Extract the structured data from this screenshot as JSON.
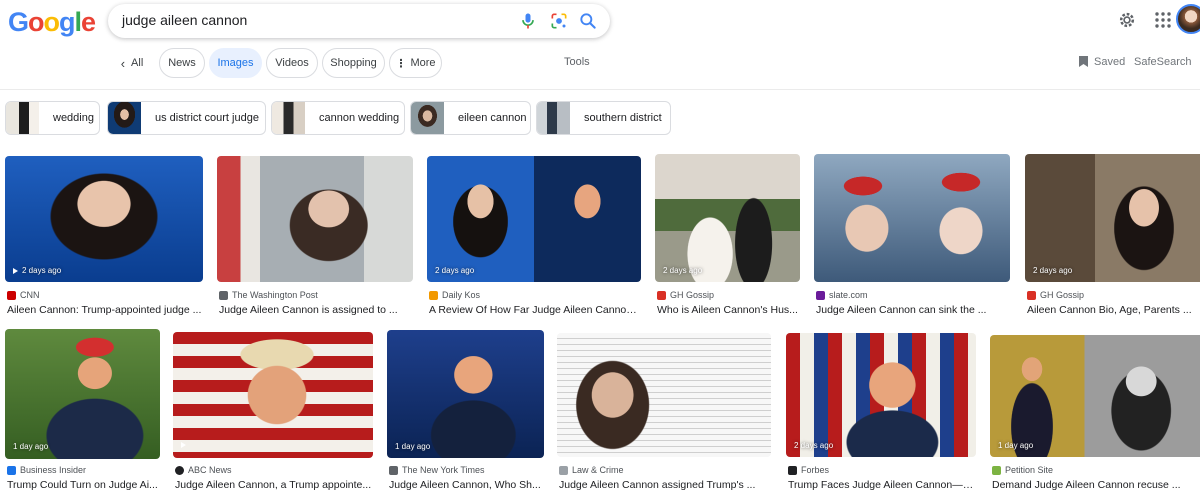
{
  "logo": {
    "letters": [
      "G",
      "o",
      "o",
      "g",
      "l",
      "e"
    ],
    "colors": [
      "#4285f4",
      "#ea4335",
      "#fbbc05",
      "#4285f4",
      "#34a853",
      "#ea4335"
    ]
  },
  "search": {
    "query": "judge aileen cannon",
    "mic_icon": "mic-icon",
    "lens_icon": "lens-icon",
    "search_icon": "search-icon"
  },
  "header": {
    "settings_icon": "gear-icon",
    "apps_icon": "apps-grid-icon",
    "account_icon": "avatar"
  },
  "tabs": {
    "all": "All",
    "news": "News",
    "images": "Images",
    "videos": "Videos",
    "shopping": "Shopping",
    "more": "More",
    "tools": "Tools",
    "saved": "Saved",
    "safesearch": "SafeSearch"
  },
  "chips": [
    {
      "label": "wedding"
    },
    {
      "label": "us district court judge"
    },
    {
      "label": "cannon wedding"
    },
    {
      "label": "eileen cannon"
    },
    {
      "label": "southern district"
    }
  ],
  "results": [
    {
      "source": "CNN",
      "favicon": "#cc0000",
      "title": "Aileen Cannon: Trump-appointed judge ...",
      "badge": "2 days ago",
      "video": true
    },
    {
      "source": "The Washington Post",
      "favicon": "#5f6368",
      "title": "Judge Aileen Cannon is assigned to ...",
      "badge": "",
      "video": false
    },
    {
      "source": "Daily Kos",
      "favicon": "#f29900",
      "title": "A Review Of How Far Judge Aileen Cannon ...",
      "badge": "2 days ago",
      "video": false
    },
    {
      "source": "GH Gossip",
      "favicon": "#d93025",
      "title": "Who is Aileen Cannon's Hus...",
      "badge": "2 days ago",
      "video": false
    },
    {
      "source": "slate.com",
      "favicon": "#6a1b9a",
      "title": "Judge Aileen Cannon can sink the ...",
      "badge": "",
      "video": false
    },
    {
      "source": "GH Gossip",
      "favicon": "#d93025",
      "title": "Aileen Cannon Bio, Age, Parents ...",
      "badge": "2 days ago",
      "video": false
    },
    {
      "source": "Business Insider",
      "favicon": "#1a73e8",
      "title": "Trump Could Turn on Judge Ai...",
      "badge": "1 day ago",
      "video": false
    },
    {
      "source": "ABC News",
      "favicon": "#202124",
      "title": "Judge Aileen Cannon, a Trump appointe...",
      "badge": "",
      "video": true
    },
    {
      "source": "The New York Times",
      "favicon": "#5f6368",
      "title": "Judge Aileen Cannon, Who Sh...",
      "badge": "1 day ago",
      "video": false
    },
    {
      "source": "Law & Crime",
      "favicon": "#9aa0a6",
      "title": "Judge Aileen Cannon assigned Trump's ...",
      "badge": "",
      "video": false
    },
    {
      "source": "Forbes",
      "favicon": "#202124",
      "title": "Trump Faces Judge Aileen Cannon—W...",
      "badge": "2 days ago",
      "video": false
    },
    {
      "source": "Petition Site",
      "favicon": "#7cb342",
      "title": "Demand Judge Aileen Cannon recuse ...",
      "badge": "1 day ago",
      "video": false
    }
  ]
}
